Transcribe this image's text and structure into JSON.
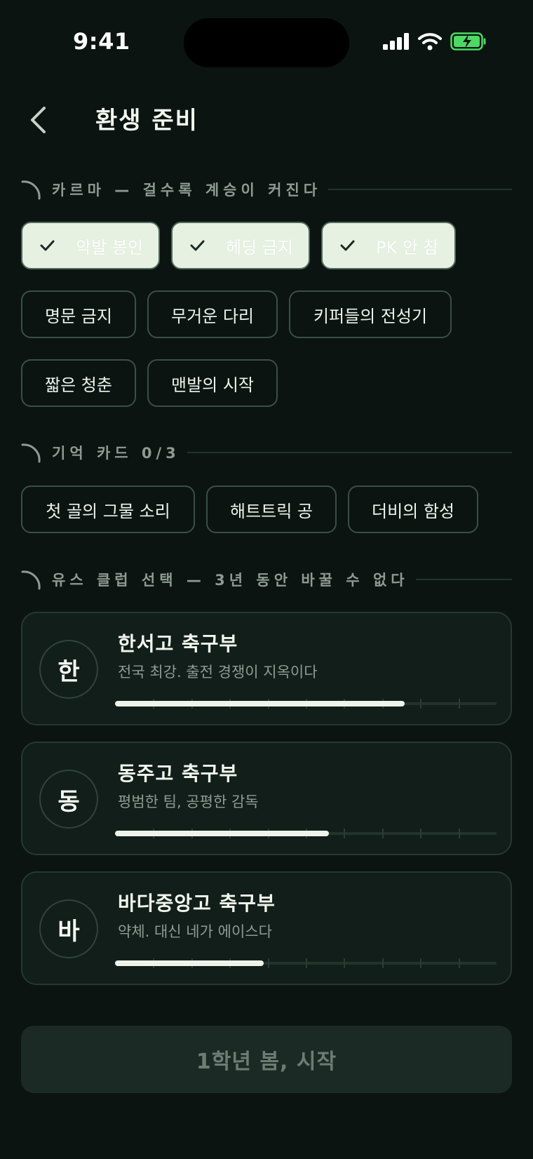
{
  "status_bar": {
    "time": "9:41"
  },
  "header": {
    "title": "환생 준비"
  },
  "karma": {
    "title": "카르마 — 걸수록 계승이 커진다",
    "chips": [
      {
        "label": "악발 봉인",
        "selected": true
      },
      {
        "label": "헤딩 금지",
        "selected": true
      },
      {
        "label": "PK 안 참",
        "selected": true
      },
      {
        "label": "명문 금지",
        "selected": false
      },
      {
        "label": "무거운 다리",
        "selected": false
      },
      {
        "label": "키퍼들의 전성기",
        "selected": false
      },
      {
        "label": "짧은 청춘",
        "selected": false
      },
      {
        "label": "맨발의 시작",
        "selected": false
      }
    ]
  },
  "memory": {
    "title": "기억 카드 0/3",
    "chips": [
      {
        "label": "첫 골의 그물 소리"
      },
      {
        "label": "해트트릭 공"
      },
      {
        "label": "더비의 함성"
      }
    ]
  },
  "youth": {
    "title": "유스 클럽 선택 — 3년 동안 바꿀 수 없다",
    "clubs": [
      {
        "badge": "한",
        "name": "한서고 축구부",
        "desc": "전국 최강. 출전 경쟁이 지옥이다",
        "level": 0.76
      },
      {
        "badge": "동",
        "name": "동주고 축구부",
        "desc": "평범한 팀, 공평한 감독",
        "level": 0.56
      },
      {
        "badge": "바",
        "name": "바다중앙고 축구부",
        "desc": "약체. 대신 네가 에이스다",
        "level": 0.39
      }
    ]
  },
  "start_button": {
    "label": "1학년 봄, 시작"
  },
  "colors": {
    "background": "#0b1411",
    "accent": "#eef4ea",
    "battery": "#4cd964"
  }
}
